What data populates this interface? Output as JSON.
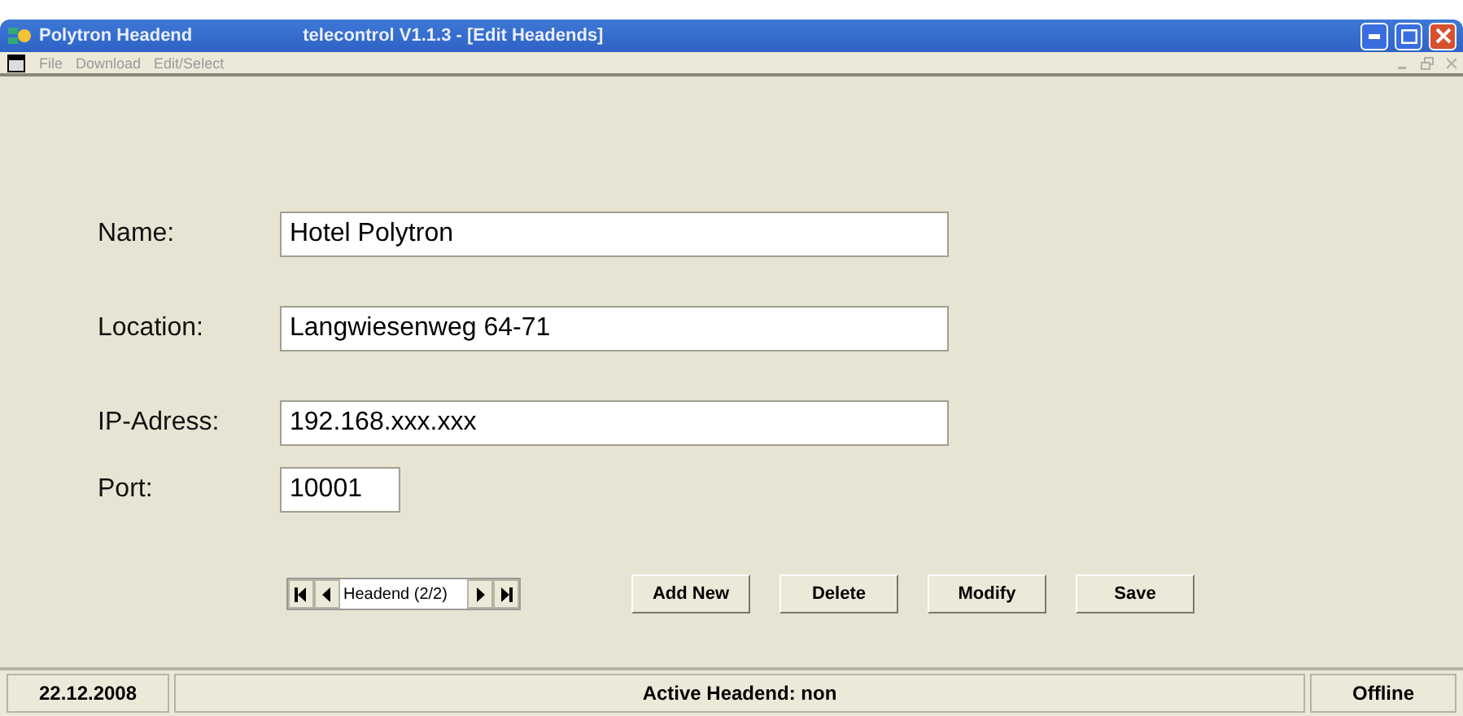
{
  "window": {
    "app_name": "Polytron Headend",
    "title": "telecontrol V1.1.3 - [Edit Headends]"
  },
  "menu": [
    "File",
    "Download",
    "Edit/Select"
  ],
  "fields": [
    {
      "label": "Name:",
      "value": "Hotel Polytron",
      "kind": "wide"
    },
    {
      "label": "Location:",
      "value": "Langwiesenweg 64-71",
      "kind": "wide"
    },
    {
      "label": "IP-Adress:",
      "value": "192.168.xxx.xxx",
      "kind": "wide"
    },
    {
      "label": "Port:",
      "value": "10001",
      "kind": "short"
    }
  ],
  "navigator": {
    "caption": "Headend (2/2)"
  },
  "buttons": [
    "Add New",
    "Delete",
    "Modify",
    "Save"
  ],
  "status_bar": {
    "date": "22.12.2008",
    "message": "Active Headend: non",
    "connection": "Offline"
  }
}
